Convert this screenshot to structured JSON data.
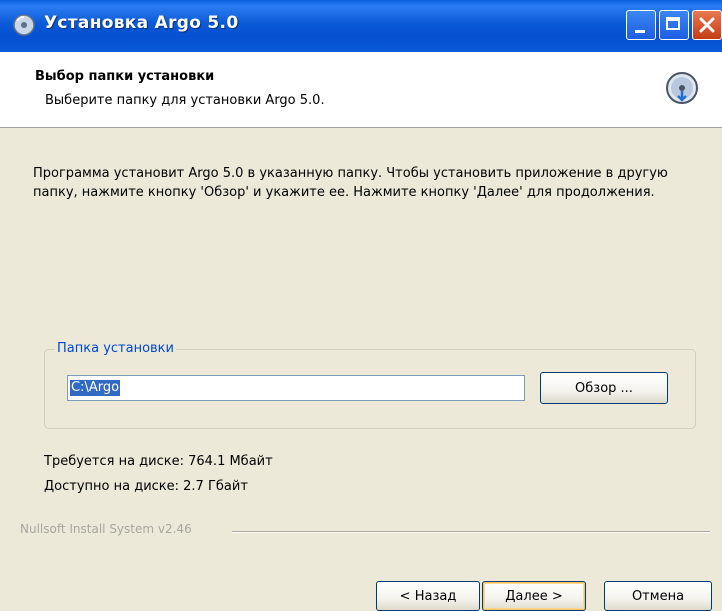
{
  "window": {
    "title": "Установка Argo 5.0",
    "accent_color": "#0a5ad6",
    "close_color": "#c53c16"
  },
  "header": {
    "title": "Выбор папки установки",
    "subtitle": "Выберите папку для установки Argo 5.0.",
    "icon": "installer-disk-icon"
  },
  "body": {
    "intro": "Программа установит Argo 5.0 в указанную папку. Чтобы установить приложение в другую папку, нажмите кнопку 'Обзор' и укажите ее. Нажмите кнопку 'Далее' для продолжения.",
    "group_label": "Папка установки",
    "install_path": "C:\\Argo",
    "browse_label": "Обзор ...",
    "disk_required": "Требуется на диске: 764.1 Мбайт",
    "disk_available": "Доступно на диске: 2.7 Гбайт"
  },
  "footer": {
    "branding": "Nullsoft Install System v2.46",
    "back_label": "< Назад",
    "next_label": "Далее >",
    "cancel_label": "Отмена"
  }
}
